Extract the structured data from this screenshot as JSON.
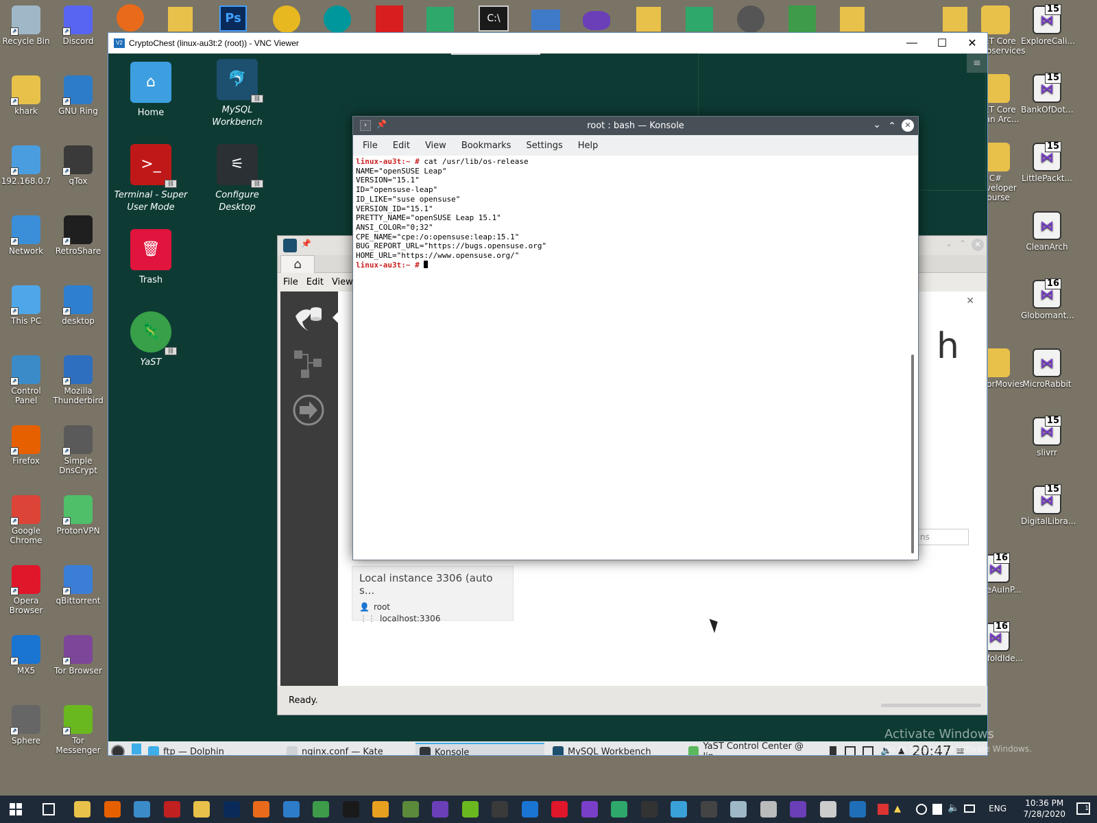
{
  "desktop_left": [
    {
      "label": "Recycle Bin",
      "icon": "recycle-bin-icon",
      "color": "#9fb8c8"
    },
    {
      "label": "Discord",
      "icon": "discord-icon",
      "color": "#5865f2"
    },
    {
      "label": "khark",
      "icon": "user-folder-icon",
      "color": "#e8c14a"
    },
    {
      "label": "GNU Ring",
      "icon": "gnu-ring-icon",
      "color": "#2d7cc9"
    },
    {
      "label": "192.168.0.7",
      "icon": "computer-icon",
      "color": "#4a9ee0"
    },
    {
      "label": "qTox",
      "icon": "qtox-icon",
      "color": "#3a3a3a"
    },
    {
      "label": "Network",
      "icon": "network-icon",
      "color": "#3a8fd8"
    },
    {
      "label": "RetroShare",
      "icon": "retroshare-icon",
      "color": "#1f1f1f"
    },
    {
      "label": "This PC",
      "icon": "this-pc-icon",
      "color": "#4fa6e8"
    },
    {
      "label": "desktop",
      "icon": "desktop-shortcut-icon",
      "color": "#2e7fcf"
    },
    {
      "label": "Control Panel",
      "icon": "control-panel-icon",
      "color": "#3a8bc8"
    },
    {
      "label": "Mozilla Thunderbird",
      "icon": "thunderbird-icon",
      "color": "#2f6fc0"
    },
    {
      "label": "Firefox",
      "icon": "firefox-icon",
      "color": "#e66000"
    },
    {
      "label": "Simple DnsCrypt",
      "icon": "dnscrypt-icon",
      "color": "#5a5a5a"
    },
    {
      "label": "Google Chrome",
      "icon": "chrome-icon",
      "color": "#db4437"
    },
    {
      "label": "ProtonVPN",
      "icon": "protonvpn-icon",
      "color": "#4fbf6a"
    },
    {
      "label": "Opera Browser",
      "icon": "opera-icon",
      "color": "#e0162b"
    },
    {
      "label": "qBittorrent",
      "icon": "qbittorrent-icon",
      "color": "#3b7ed8"
    },
    {
      "label": "MX5",
      "icon": "maxthon-icon",
      "color": "#1a74d1"
    },
    {
      "label": "Tor Browser",
      "icon": "tor-browser-icon",
      "color": "#7d4698"
    },
    {
      "label": "Sphere",
      "icon": "sphere-icon",
      "color": "#666666"
    },
    {
      "label": "Tor Messenger",
      "icon": "tor-messenger-icon",
      "color": "#6ab820"
    }
  ],
  "desktop_right": [
    {
      "label": ".NET Core Microservices",
      "icon": "folder-icon",
      "badge": ""
    },
    {
      "label": "ExploreCali...",
      "icon": "visual-studio-icon",
      "badge": "15"
    },
    {
      "label": ".NET Core Clean Arc...",
      "icon": "folder-icon",
      "badge": ""
    },
    {
      "label": "BankOfDot...",
      "icon": "visual-studio-icon",
      "badge": "15"
    },
    {
      "label": "C# Developer Course",
      "icon": "folder-icon",
      "badge": ""
    },
    {
      "label": "LittlePackt...",
      "icon": "visual-studio-icon",
      "badge": "15"
    },
    {
      "label": "CleanArch",
      "icon": "visual-studio-icon",
      "badge": ""
    },
    {
      "label": "Globomant...",
      "icon": "visual-studio-icon",
      "badge": "16"
    },
    {
      "label": "BlazorMovies",
      "icon": "folder-icon",
      "badge": ""
    },
    {
      "label": "MicroRabbit",
      "icon": "visual-studio-icon",
      "badge": ""
    },
    {
      "label": "slivrr",
      "icon": "visual-studio-icon",
      "badge": "15"
    },
    {
      "label": "DigitalLibra...",
      "icon": "visual-studio-icon",
      "badge": "15"
    },
    {
      "label": "StoreAuInP...",
      "icon": "visual-studio-icon",
      "badge": "16"
    },
    {
      "label": "ScaffoldIde...",
      "icon": "visual-studio-icon",
      "badge": "16"
    }
  ],
  "vnc": {
    "title": "CryptoChest (linux-au3t:2 (root)) - VNC Viewer",
    "badge": "V2"
  },
  "linux_desktop": [
    {
      "label": "Home",
      "icon": "home-folder-icon"
    },
    {
      "label": "MySQL Workbench",
      "icon": "mysql-workbench-icon"
    },
    {
      "label": "Terminal - Super User Mode",
      "icon": "terminal-icon"
    },
    {
      "label": "Configure Desktop",
      "icon": "configure-desktop-icon"
    },
    {
      "label": "Trash",
      "icon": "trash-icon"
    },
    {
      "label": "YaST",
      "icon": "yast-icon"
    }
  ],
  "konsole": {
    "title": "root : bash — Konsole",
    "menu": [
      "File",
      "Edit",
      "View",
      "Bookmarks",
      "Settings",
      "Help"
    ],
    "prompt": "linux-au3t:~ #",
    "command": " cat /usr/lib/os-release",
    "output": "NAME=\"openSUSE Leap\"\nVERSION=\"15.1\"\nID=\"opensuse-leap\"\nID_LIKE=\"suse opensuse\"\nVERSION_ID=\"15.1\"\nPRETTY_NAME=\"openSUSE Leap 15.1\"\nANSI_COLOR=\"0;32\"\nCPE_NAME=\"cpe:/o:opensuse:leap:15.1\"\nBUG_REPORT_URL=\"https://bugs.opensuse.org\"\nHOME_URL=\"https://www.opensuse.org/\""
  },
  "workbench": {
    "menu": [
      "File",
      "Edit",
      "View"
    ],
    "status": "Ready.",
    "connection": {
      "title": "Local instance 3306 (auto s...",
      "user": "root",
      "host": "localhost:3306"
    },
    "partial_text": "ns"
  },
  "kde_taskbar": {
    "tasks": [
      {
        "label": "ftp — Dolphin",
        "active": false,
        "color": "#3daee9"
      },
      {
        "label": "nginx.conf  — Kate",
        "active": false,
        "color": "#cfd3d6"
      },
      {
        "label": "Konsole",
        "active": true,
        "color": "#31363b"
      },
      {
        "label": "MySQL Workbench",
        "active": false,
        "color": "#1d4f6e"
      },
      {
        "label": "YaST Control Center @ lin...",
        "active": false,
        "color": "#5cb85c"
      }
    ],
    "clock": "20:47"
  },
  "watermark": {
    "line1": "Activate Windows",
    "line2": "Go to Settings to activate Windows."
  },
  "win_taskbar": {
    "time": "10:36 PM",
    "date": "7/28/2020",
    "lang": "ENG",
    "notification_count": "1"
  }
}
